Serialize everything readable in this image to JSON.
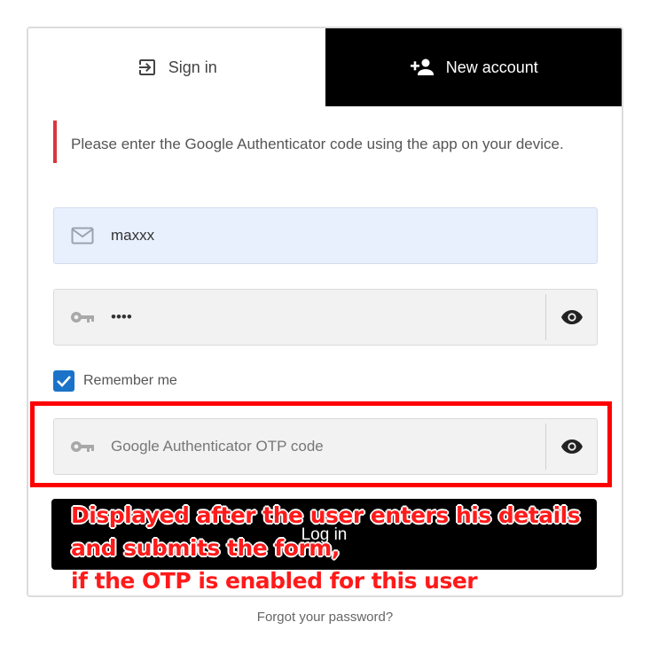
{
  "tabs": {
    "signin": {
      "label": "Sign in",
      "icon": "sign-in-icon"
    },
    "new_account": {
      "label": "New account",
      "icon": "add-person-icon"
    }
  },
  "notice": {
    "text": "Please enter the Google Authenticator code using the app on your device."
  },
  "email_field": {
    "value": "maxxx",
    "icon": "mail-icon"
  },
  "password_field": {
    "value": "••••",
    "icon": "key-icon",
    "toggle_icon": "eye-icon"
  },
  "remember": {
    "label": "Remember me",
    "checked": true
  },
  "otp_field": {
    "placeholder": "Google Authenticator OTP code",
    "icon": "key-icon",
    "toggle_icon": "eye-icon"
  },
  "login_button": {
    "label": "Log in"
  },
  "annotation": {
    "lines": [
      "Displayed after the user enters his details",
      "and submits the form,",
      "if the OTP is enabled for this user"
    ],
    "color": "#ff0000"
  },
  "forgot_link": {
    "label": "Forgot your password?"
  },
  "colors": {
    "accent": "#1a73c8",
    "notice_border": "#d9363e",
    "dark": "#000000"
  }
}
